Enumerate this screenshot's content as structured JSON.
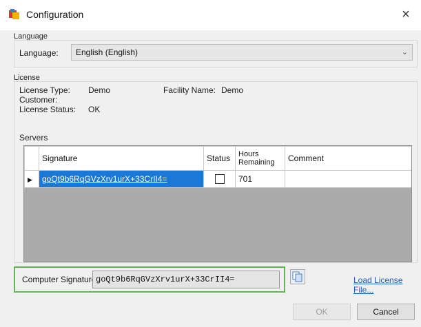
{
  "window": {
    "title": "Configuration",
    "close_glyph": "×"
  },
  "language_group": {
    "title": "Language",
    "label": "Language:",
    "selected": "English (English)"
  },
  "license_group": {
    "title": "License",
    "type_label": "License Type:",
    "type_value": "Demo",
    "facility_label": "Facility Name:",
    "facility_value": "Demo",
    "customer_label": "Customer:",
    "status_label": "License Status:",
    "status_value": "OK"
  },
  "servers": {
    "title": "Servers",
    "columns": {
      "signature": "Signature",
      "status": "Status",
      "hours_line1": "Hours",
      "hours_line2": "Remaining",
      "comment": "Comment"
    },
    "rows": [
      {
        "signature": "goQt9b6RqGVzXrv1urX+33CrII4=",
        "status_checked": false,
        "hours_remaining": "701",
        "comment": ""
      }
    ]
  },
  "computer_signature": {
    "label": "Computer Signature:",
    "value": "goQt9b6RqGVzXrv1urX+33CrII4="
  },
  "load_license_link": "Load License File...",
  "buttons": {
    "ok": "OK",
    "cancel": "Cancel"
  },
  "colors": {
    "selection": "#1a78d6",
    "highlight_border": "#5fb653",
    "link": "#1b5dc4"
  }
}
